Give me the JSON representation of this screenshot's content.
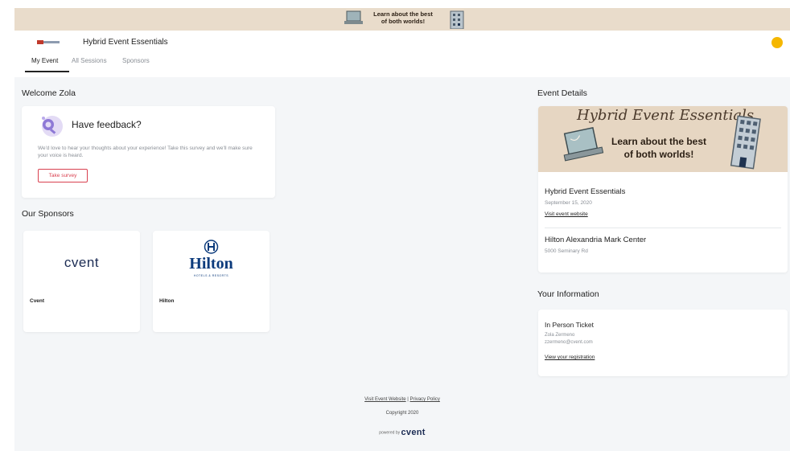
{
  "banner": {
    "script_text": "Hybrid Event Essentials",
    "text_line1": "Learn about the best",
    "text_line2": "of both worlds!"
  },
  "header": {
    "title": "Hybrid Event Essentials",
    "tabs": [
      {
        "label": "My Event",
        "active": true
      },
      {
        "label": "All Sessions",
        "active": false
      },
      {
        "label": "Sponsors",
        "active": false
      }
    ]
  },
  "welcome": {
    "heading": "Welcome Zola",
    "feedback": {
      "title": "Have feedback?",
      "body": "We'd love to hear your thoughts about your experience! Take this survey and we'll make sure your voice is heard.",
      "button": "Take survey"
    }
  },
  "sponsors": {
    "heading": "Our Sponsors",
    "items": [
      {
        "name": "Cvent",
        "logo_text": "cvent"
      },
      {
        "name": "Hilton",
        "logo_text": "Hilton",
        "logo_sub": "HOTELS & RESORTS"
      }
    ]
  },
  "event_details": {
    "heading": "Event Details",
    "banner_script": "Hybrid Event Essentials",
    "banner_line1": "Learn about the best",
    "banner_line2": "of both worlds!",
    "name": "Hybrid Event Essentials",
    "date": "September 15, 2020",
    "website_link": "Visit event website",
    "venue": "Hilton Alexandria Mark Center",
    "address": "5000 Seminary Rd"
  },
  "your_information": {
    "heading": "Your Information",
    "ticket": "In Person Ticket",
    "name": "Zola Zermeno",
    "email": "zzermeno@cvent.com",
    "link": "View your registration"
  },
  "footer": {
    "website_link": "Visit Event Website",
    "separator": "|",
    "privacy_link": "Privacy Policy",
    "copyright": "Copyright 2020",
    "powered_by": "powered by",
    "powered_logo": "cvent"
  },
  "colors": {
    "accent_red": "#d94150",
    "avatar": "#f5b700",
    "banner_bg": "#e6d6c2",
    "cvent_navy": "#1c2c54",
    "hilton_blue": "#0c3b7c"
  }
}
